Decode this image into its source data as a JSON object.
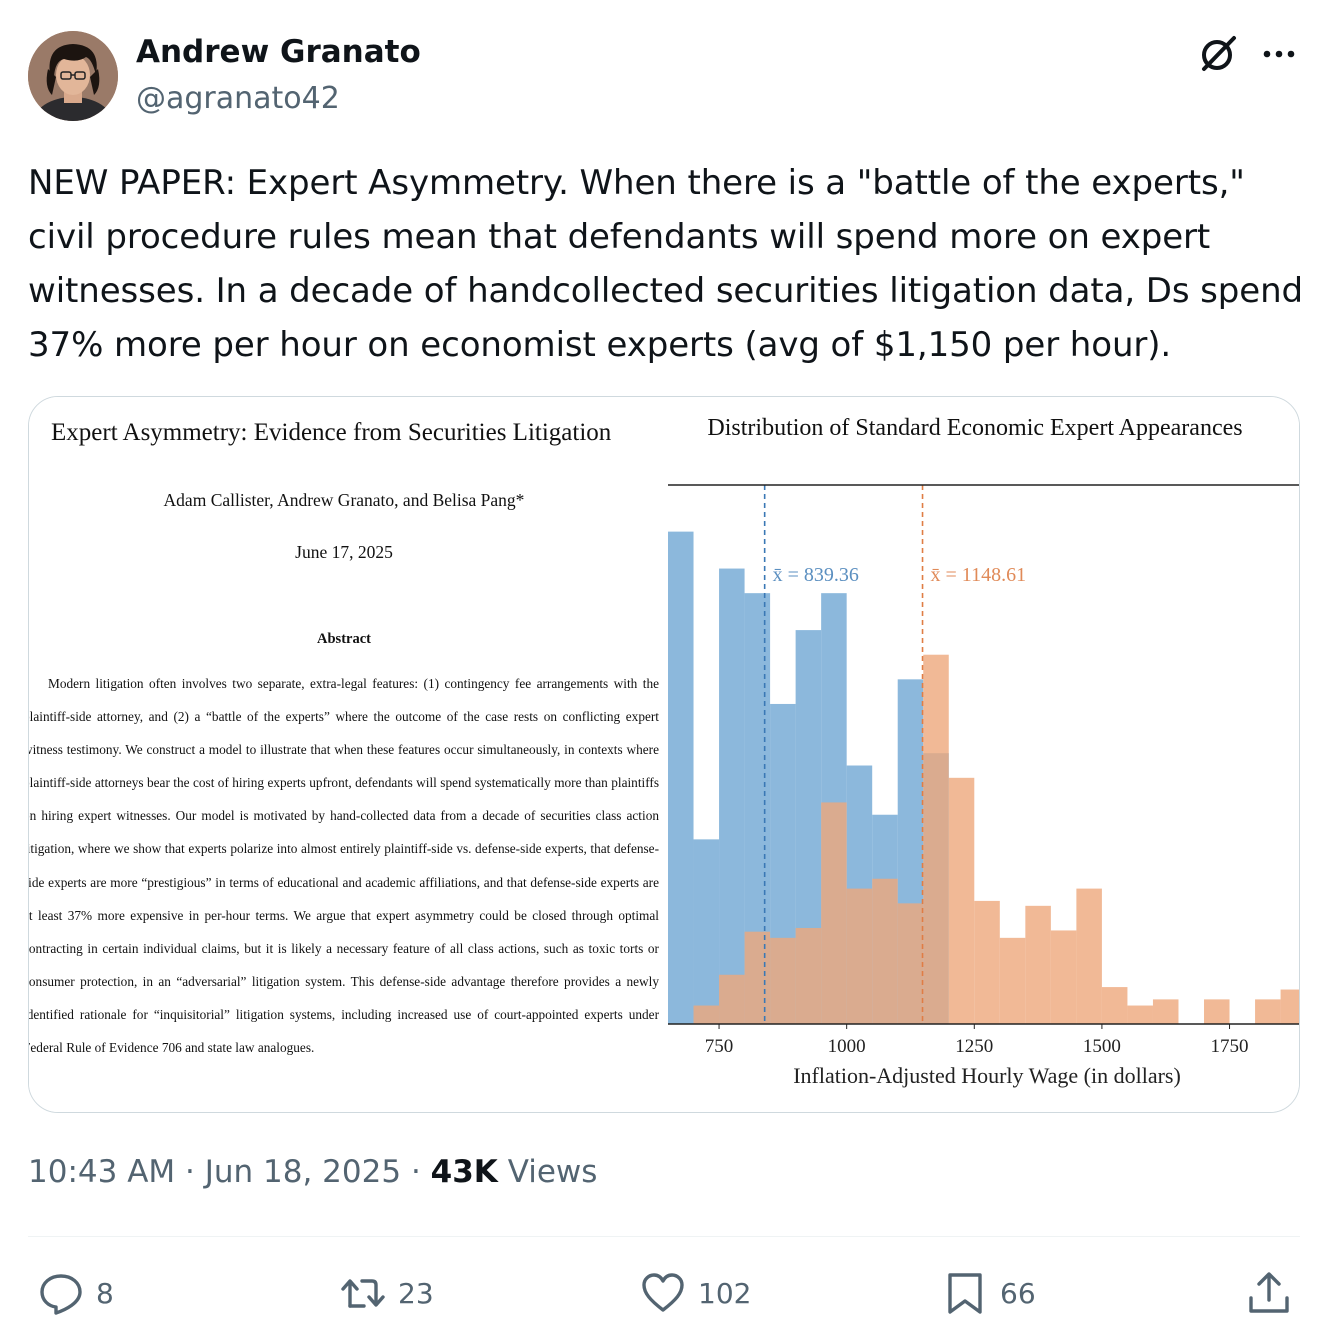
{
  "author": {
    "display_name": "Andrew Granato",
    "handle": "@agranato42"
  },
  "icons": {
    "grok": "grok-icon",
    "more": "more-options-icon",
    "reply": "reply-icon",
    "retweet": "retweet-icon",
    "like": "heart-icon",
    "bookmark": "bookmark-icon",
    "share": "share-icon"
  },
  "tweet": {
    "text": "NEW PAPER: Expert Asymmetry. When there is a \"battle of the experts,\" civil procedure rules mean that defendants will spend more on expert witnesses. In a decade of handcollected securities litigation data, Ds spend 37% more per hour on economist experts (avg of $1,150 per hour).",
    "time": "10:43 AM",
    "date": "Jun 18, 2025",
    "views_count": "43K",
    "views_label": "Views"
  },
  "paper": {
    "title": "Expert Asymmetry: Evidence from Securities Litigation",
    "authors": "Adam Callister, Andrew Granato, and Belisa Pang*",
    "date": "June 17, 2025",
    "abstract_heading": "Abstract",
    "abstract": "Modern litigation often involves two separate, extra-legal features: (1) contingency fee arrangements with the plaintiff-side attorney, and (2) a “battle of the experts” where the outcome of the case rests on conflicting expert witness testimony. We construct a model to illustrate that when these features occur simultaneously, in contexts where plaintiff-side attorneys bear the cost of hiring experts upfront, defendants will spend systematically more than plaintiffs on hiring expert witnesses. Our model is motivated by hand-collected data from a decade of securities class action litigation, where we show that experts polarize into almost entirely plaintiff-side vs. defense-side experts, that defense-side experts are more “prestigious” in terms of educational and academic affiliations, and that defense-side experts are at least 37% more expensive in per-hour terms. We argue that expert asymmetry could be closed through optimal contracting in certain individual claims, but it is likely a necessary feature of all class actions, such as toxic torts or consumer protection, in an “adversarial” litigation system. This defense-side advantage therefore provides a newly identified rationale for “inquisitorial” litigation systems, including increased use of court-appointed experts under Federal Rule of Evidence 706 and state law analogues."
  },
  "actions": {
    "replies": "8",
    "retweets": "23",
    "likes": "102",
    "bookmarks": "66"
  },
  "colors": {
    "blue": "#6fa6d3",
    "orange": "#eea77c",
    "overlap": "#a88978",
    "text_secondary": "#536471"
  },
  "chart_data": {
    "type": "histogram",
    "title": "Distribution of Standard Economic Expert Appearances",
    "xlabel": "Inflation-Adjusted Hourly Wage (in dollars)",
    "xlim": [
      650,
      1890
    ],
    "ylim": [
      0,
      21
    ],
    "bin_width": 50,
    "xticks": [
      750,
      1000,
      1250,
      1500,
      1750
    ],
    "annotations": [
      {
        "text": "x̄ = 839.36",
        "x": 839.36,
        "series": 0
      },
      {
        "text": "x̄ = 1148.61",
        "x": 1148.61,
        "series": 1
      }
    ],
    "series": [
      {
        "color": "#6fa6d3",
        "mean": 839.36,
        "bins": [
          650,
          700,
          750,
          800,
          850,
          900,
          950,
          1000,
          1050,
          1100,
          1150
        ],
        "counts": [
          20,
          7.5,
          18.5,
          17.5,
          13,
          16,
          17.5,
          10.5,
          8.5,
          14,
          11
        ]
      },
      {
        "color": "#eea77c",
        "mean": 1148.61,
        "bins": [
          650,
          700,
          750,
          800,
          850,
          900,
          950,
          1000,
          1050,
          1100,
          1150,
          1200,
          1250,
          1300,
          1350,
          1400,
          1450,
          1500,
          1550,
          1600,
          1650,
          1700,
          1750,
          1800,
          1850
        ],
        "counts": [
          0,
          0.75,
          2,
          3.75,
          3.5,
          3.9,
          9,
          5.5,
          5.9,
          4.9,
          15,
          10,
          5,
          3.5,
          4.8,
          3.8,
          5.5,
          1.5,
          0.75,
          1,
          0,
          1,
          0,
          1,
          1.4
        ]
      }
    ]
  }
}
